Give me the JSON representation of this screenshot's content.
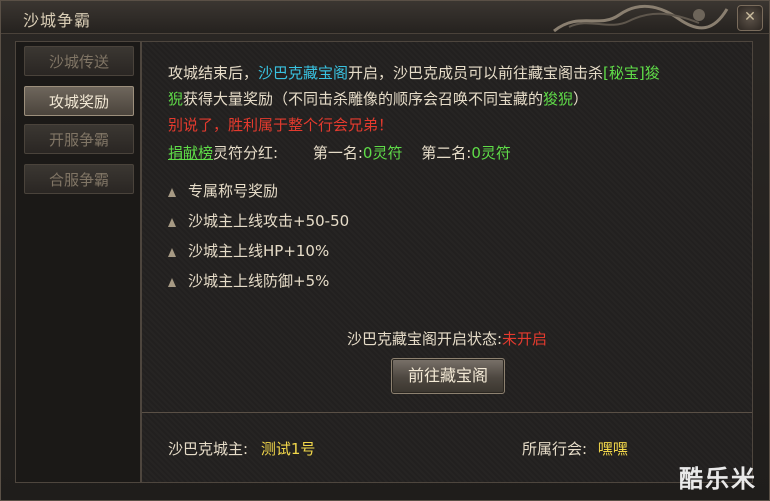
{
  "window": {
    "title": "沙城争霸",
    "close_icon": "close-icon"
  },
  "sidebar": {
    "items": [
      {
        "label": "沙城传送",
        "state": "normal"
      },
      {
        "label": "攻城奖励",
        "state": "active"
      },
      {
        "label": "开服争霸",
        "state": "disabled"
      },
      {
        "label": "合服争霸",
        "state": "disabled"
      }
    ]
  },
  "content": {
    "intro": {
      "p1": "攻城结束后，",
      "vault": "沙巴克藏宝阁",
      "p2": "开启，沙巴克成员可以前往藏宝阁击杀",
      "secret": "[秘宝]狻",
      "secret2": "猊",
      "p3": "获得大量奖励（不同击杀雕像的顺序会召唤不同宝藏的",
      "beast": "狻猊",
      "p4": "）"
    },
    "slogan": "别说了，胜利属于整个行会兄弟！",
    "contrib": {
      "board": "捐献榜",
      "label": "灵符分红:",
      "first_label": "第一名:",
      "first_value": "0灵符",
      "second_label": "第二名:",
      "second_value": "0灵符"
    },
    "rewards": [
      "专属称号奖励",
      "沙城主上线攻击+50-50",
      "沙城主上线HP+10%",
      "沙城主上线防御+5%"
    ],
    "status_label": "沙巴克藏宝阁开启状态:",
    "status_value": "未开启",
    "goto_button": "前往藏宝阁",
    "footer": {
      "owner_label": "沙巴克城主:",
      "owner_value": "测试1号",
      "guild_label": "所属行会:",
      "guild_value": "嘿嘿"
    }
  },
  "watermark": "酷乐米",
  "colors": {
    "highlight_cyan": "#39c2e0",
    "highlight_green": "#5fdc48",
    "alert_red": "#e43a2e",
    "name_yellow": "#f2d74a"
  }
}
